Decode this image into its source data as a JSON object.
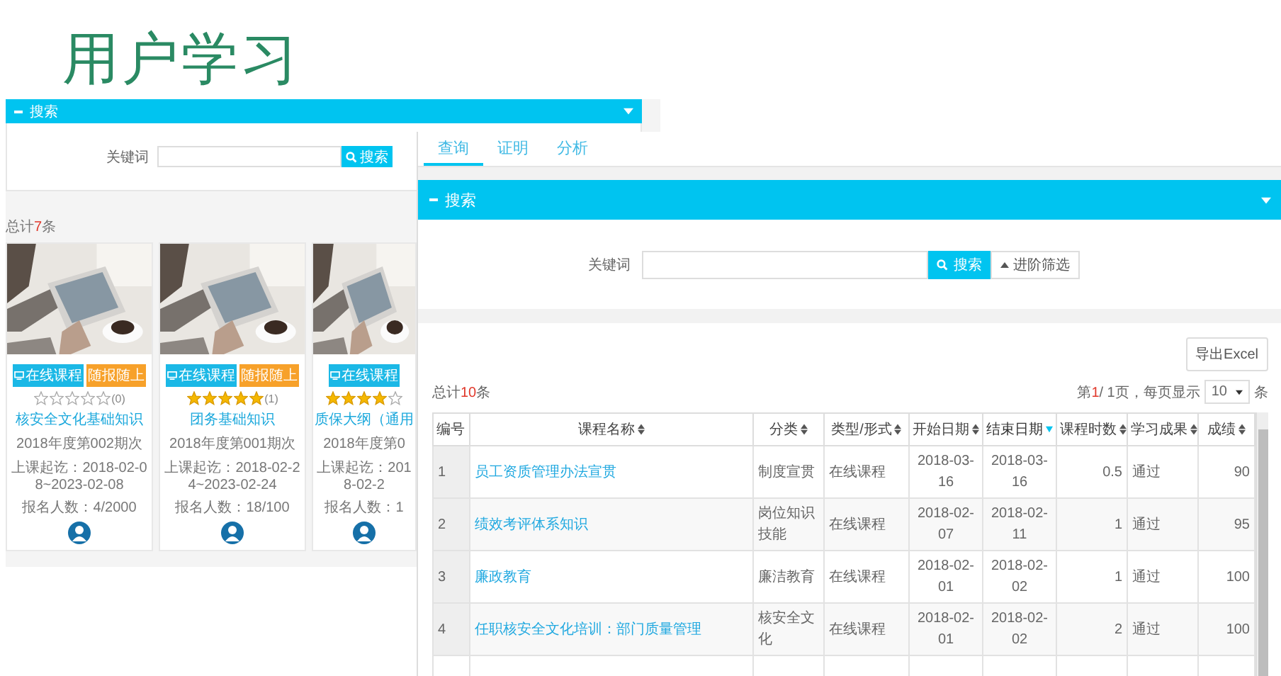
{
  "title": "用户学习",
  "left_panel": {
    "bar_title": "搜索",
    "keyword_label": "关键词",
    "search_button": "搜索",
    "total": {
      "prefix": "总计",
      "count": "7",
      "suffix": "条"
    },
    "cards": [
      {
        "badges": [
          {
            "label": "在线课程",
            "kind": "type"
          },
          {
            "label": "随报随上",
            "kind": "schedule"
          }
        ],
        "stars": 0,
        "rating_count": "(0)",
        "title": "核安全文化基础知识",
        "session": "2018年度第002期次",
        "period": "上课起讫：2018-02-08~2023-02-08",
        "enrollment": "报名人数：4/2000"
      },
      {
        "badges": [
          {
            "label": "在线课程",
            "kind": "type"
          },
          {
            "label": "随报随上",
            "kind": "schedule"
          }
        ],
        "stars": 5,
        "rating_count": "(1)",
        "title": "团务基础知识",
        "session": "2018年度第001期次",
        "period": "上课起讫：2018-02-24~2023-02-24",
        "enrollment": "报名人数：18/100"
      },
      {
        "badges": [
          {
            "label": "在线课程",
            "kind": "type"
          }
        ],
        "stars": 4,
        "title": "质保大纲（通用",
        "session": "2018年度第0",
        "period": "上课起讫：2018-02-2",
        "enrollment": "报名人数：1"
      }
    ]
  },
  "right_panel": {
    "tabs": [
      {
        "label": "查询",
        "selected": true
      },
      {
        "label": "证明",
        "selected": false
      },
      {
        "label": "分析",
        "selected": false
      }
    ],
    "bar_title": "搜索",
    "keyword_label": "关键词",
    "search_button": "搜索",
    "advanced_button": "进阶筛选",
    "export_button": "导出Excel",
    "total": {
      "prefix": "总计",
      "count": "10",
      "suffix": "条"
    },
    "pager": {
      "prefix": "第",
      "current": "1",
      "suffix": "/ 1页，每页显示",
      "page_size": "10",
      "unit": "条"
    },
    "table": {
      "columns": [
        {
          "label": "编号",
          "sortable": false,
          "sorted": false
        },
        {
          "label": "课程名称",
          "sortable": true,
          "sorted": false
        },
        {
          "label": "分类",
          "sortable": true,
          "sorted": false
        },
        {
          "label": "类型/形式",
          "sortable": true,
          "sorted": false
        },
        {
          "label": "开始日期",
          "sortable": true,
          "sorted": false
        },
        {
          "label": "结束日期",
          "sortable": true,
          "sorted": true
        },
        {
          "label": "课程时数",
          "sortable": true,
          "sorted": false
        },
        {
          "label": "学习成果",
          "sortable": true,
          "sorted": false
        },
        {
          "label": "成绩",
          "sortable": true,
          "sorted": false
        }
      ],
      "rows": [
        [
          "1",
          "员工资质管理办法宣贯",
          "制度宣贯",
          "在线课程",
          "2018-03-16",
          "2018-03-16",
          "0.5",
          "通过",
          "90"
        ],
        [
          "2",
          "绩效考评体系知识",
          "岗位知识技能",
          "在线课程",
          "2018-02-07",
          "2018-02-11",
          "1",
          "通过",
          "95"
        ],
        [
          "3",
          "廉政教育",
          "廉洁教育",
          "在线课程",
          "2018-02-01",
          "2018-02-02",
          "1",
          "通过",
          "100"
        ],
        [
          "4",
          "任职核安全文化培训：部门质量管理",
          "核安全文化",
          "在线课程",
          "2018-02-01",
          "2018-02-02",
          "2",
          "通过",
          "100"
        ]
      ]
    }
  }
}
